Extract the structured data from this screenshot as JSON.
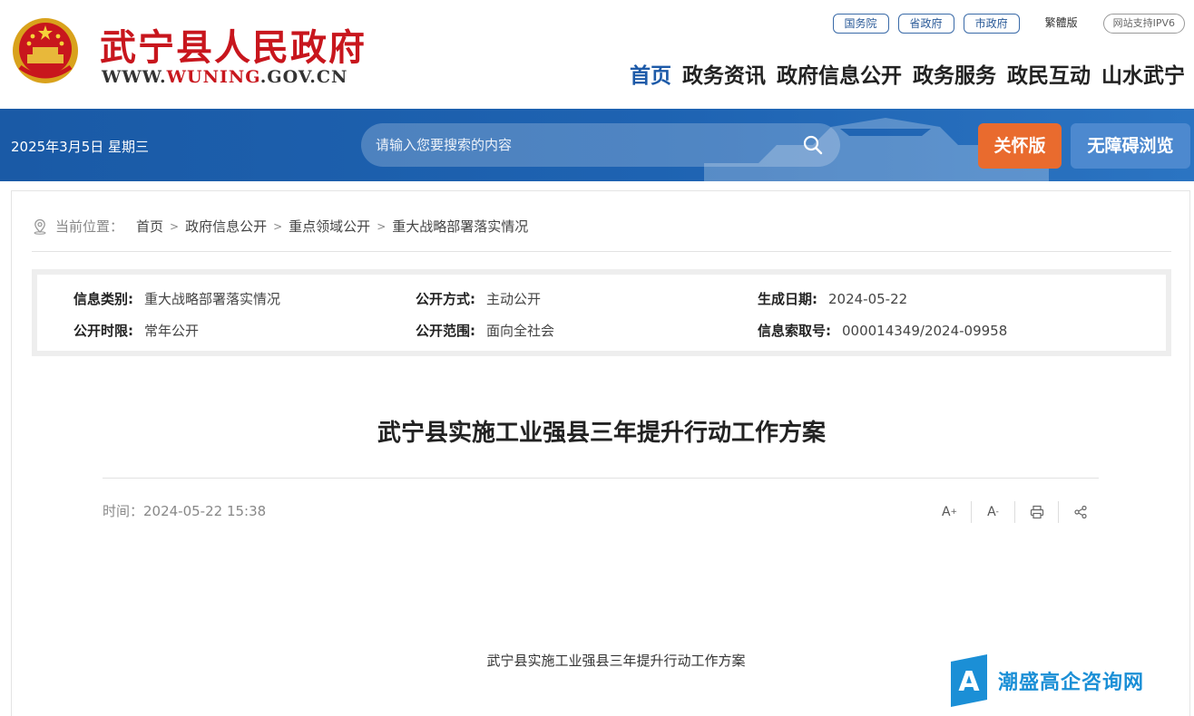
{
  "site": {
    "title": "武宁县人民政府",
    "url_prefix": "WWW.",
    "url_main": "WUNING",
    "url_suffix": ".GOV.CN"
  },
  "toplinks": [
    "国务院",
    "省政府",
    "市政府"
  ],
  "lang_switch": "繁體版",
  "ipv6": "网站支持IPV6",
  "nav": [
    "首页",
    "政务资讯",
    "政府信息公开",
    "政务服务",
    "政民互动",
    "山水武宁"
  ],
  "bar": {
    "date": "2025年3月5日 星期三",
    "search_placeholder": "请输入您要搜索的内容",
    "care_label": "关怀版",
    "a11y_label": "无障碍浏览"
  },
  "breadcrumb": {
    "label": "当前位置：",
    "items": [
      "首页",
      "政府信息公开",
      "重点领域公开",
      "重大战略部署落实情况"
    ]
  },
  "info": {
    "category_k": "信息类别:",
    "category_v": "重大战略部署落实情况",
    "method_k": "公开方式:",
    "method_v": "主动公开",
    "date_k": "生成日期:",
    "date_v": "2024-05-22",
    "period_k": "公开时限:",
    "period_v": "常年公开",
    "scope_k": "公开范围:",
    "scope_v": "面向全社会",
    "index_k": "信息索取号:",
    "index_v": "000014349/2024-09958"
  },
  "article": {
    "title": "武宁县实施工业强县三年提升行动工作方案",
    "time": "时间：2024-05-22 15:38",
    "body_title": "武宁县实施工业强县三年提升行动工作方案"
  },
  "tools": {
    "font_up": "A",
    "font_down": "A",
    "plus": "+",
    "minus": "-"
  },
  "watermark": {
    "text": "潮盛高企咨询网",
    "mark": "A"
  },
  "colors": {
    "brand_red": "#c8161d",
    "brand_blue": "#1d5aa8",
    "care_orange": "#e96b2e"
  },
  "icons": [
    "national-emblem",
    "search-icon",
    "location-icon",
    "print-icon",
    "share-icon"
  ]
}
